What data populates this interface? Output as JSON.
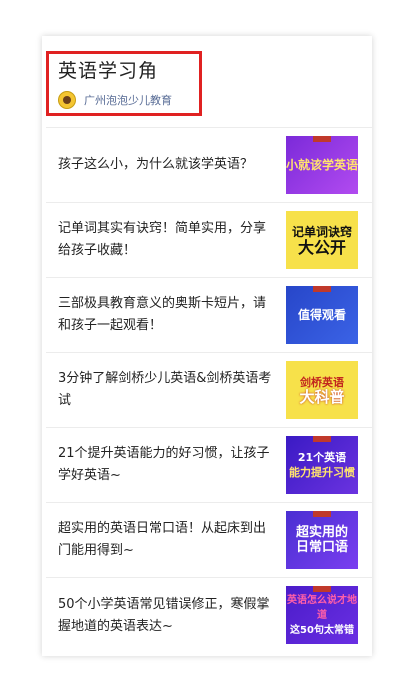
{
  "header": {
    "title": "英语学习角",
    "account_name": "广州泡泡少儿教育"
  },
  "articles": [
    {
      "title": "孩子这么小，为什么就该学英语？",
      "thumb_text": "小就该学英语"
    },
    {
      "title": "记单词其实有诀窍！简单实用，分享给孩子收藏！",
      "thumb_line1": "记单词诀窍",
      "thumb_line2": "大公开"
    },
    {
      "title": "三部极具教育意义的奥斯卡短片，请和孩子一起观看！",
      "thumb_text": "值得观看"
    },
    {
      "title": "3分钟了解剑桥少儿英语&剑桥英语考试",
      "thumb_line1": "剑桥英语",
      "thumb_line2": "大科普"
    },
    {
      "title": "21个提升英语能力的好习惯，让孩子学好英语~",
      "thumb_line1": "21个英语",
      "thumb_line2": "能力提升习惯"
    },
    {
      "title": "超实用的英语日常口语！从起床到出门能用得到~",
      "thumb_line1": "超实用的",
      "thumb_line2": "日常口语"
    },
    {
      "title": "50个小学英语常见错误修正，寒假掌握地道的英语表达~",
      "thumb_line1": "英语怎么说才地道",
      "thumb_line2": "这50句太常错"
    }
  ]
}
